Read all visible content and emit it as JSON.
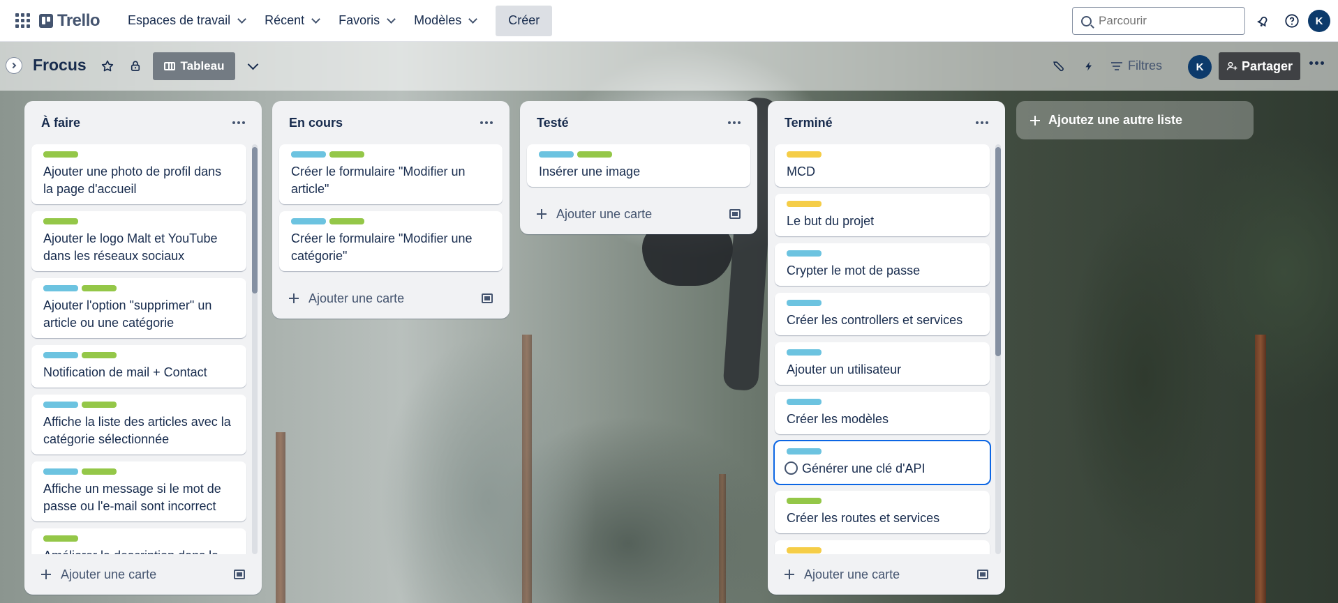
{
  "topnav": {
    "logo": "Trello",
    "items": [
      {
        "label": "Espaces de travail"
      },
      {
        "label": "Récent"
      },
      {
        "label": "Favoris"
      },
      {
        "label": "Modèles"
      }
    ],
    "create_label": "Créer",
    "search_placeholder": "Parcourir",
    "avatar_initial": "K"
  },
  "board": {
    "title": "Frocus",
    "view_label": "Tableau",
    "filters_label": "Filtres",
    "share_label": "Partager",
    "member_initial": "K"
  },
  "colors": {
    "green": "#94c748",
    "blue": "#6cc3e0",
    "yellow": "#f5cd47"
  },
  "lists": [
    {
      "title": "À faire",
      "add_label": "Ajouter une carte",
      "cards": [
        {
          "labels": [
            "green"
          ],
          "text": "Ajouter une photo de profil dans la page d'accueil"
        },
        {
          "labels": [
            "green"
          ],
          "text": "Ajouter le logo Malt et YouTube dans les réseaux sociaux"
        },
        {
          "labels": [
            "blue",
            "green"
          ],
          "text": "Ajouter l'option \"supprimer\" un article ou une catégorie"
        },
        {
          "labels": [
            "blue",
            "green"
          ],
          "text": "Notification de mail + Contact"
        },
        {
          "labels": [
            "blue",
            "green"
          ],
          "text": "Affiche la liste des articles avec la catégorie sélectionnée"
        },
        {
          "labels": [
            "blue",
            "green"
          ],
          "text": "Affiche un message si le mot de passe ou l'e-mail sont incorrect"
        },
        {
          "labels": [
            "green"
          ],
          "text": "Améliorer la description dans la"
        }
      ]
    },
    {
      "title": "En cours",
      "add_label": "Ajouter une carte",
      "cards": [
        {
          "labels": [
            "blue",
            "green"
          ],
          "text": "Créer le formulaire \"Modifier un article\""
        },
        {
          "labels": [
            "blue",
            "green"
          ],
          "text": "Créer le formulaire \"Modifier une catégorie\""
        }
      ]
    },
    {
      "title": "Testé",
      "add_label": "Ajouter une carte",
      "cards": [
        {
          "labels": [
            "blue",
            "green"
          ],
          "text": "Insérer une image"
        }
      ]
    },
    {
      "title": "Terminé",
      "add_label": "Ajouter une carte",
      "cards": [
        {
          "labels": [
            "yellow"
          ],
          "text": "MCD"
        },
        {
          "labels": [
            "yellow"
          ],
          "text": "Le but du projet"
        },
        {
          "labels": [
            "blue"
          ],
          "text": "Crypter le mot de passe"
        },
        {
          "labels": [
            "blue"
          ],
          "text": "Créer les controllers et services"
        },
        {
          "labels": [
            "blue"
          ],
          "text": "Ajouter un utilisateur"
        },
        {
          "labels": [
            "blue"
          ],
          "text": "Créer les modèles"
        },
        {
          "labels": [
            "blue"
          ],
          "text": "Générer une clé d'API",
          "active": true
        },
        {
          "labels": [
            "green"
          ],
          "text": "Créer les routes et services"
        },
        {
          "labels": [
            "yellow"
          ],
          "text": ""
        }
      ]
    }
  ],
  "add_list_label": "Ajoutez une autre liste"
}
